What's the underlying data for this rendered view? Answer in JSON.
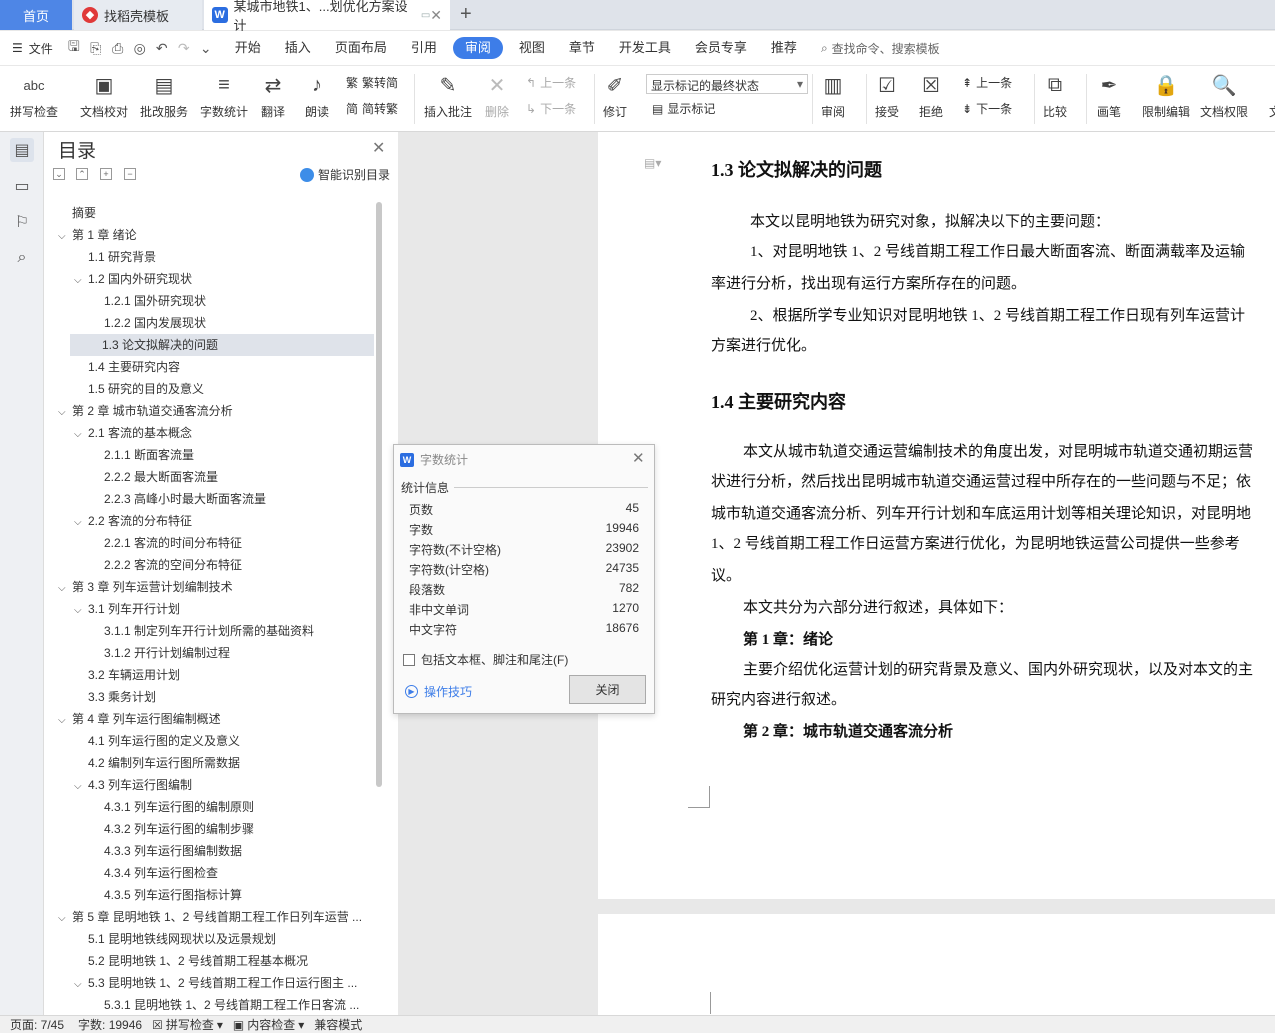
{
  "tabs": {
    "home": "首页",
    "template": "找稻壳模板",
    "doc": "某城市地铁1、...划优化方案设计"
  },
  "menubar": {
    "file": "文件",
    "items": [
      "开始",
      "插入",
      "页面布局",
      "引用",
      "审阅",
      "视图",
      "章节",
      "开发工具",
      "会员专享",
      "推荐"
    ],
    "active": "审阅",
    "search": "查找命令、搜索模板"
  },
  "ribbon": {
    "spellcheck": "拼写检查",
    "proofread": "文档校对",
    "batch": "批改服务",
    "wordcount": "字数统计",
    "translate": "翻译",
    "read": "朗读",
    "to_trad": "繁转简",
    "to_simp": "简转繁",
    "insert_comment": "插入批注",
    "delete": "删除",
    "prev_comment": "上一条",
    "next_comment": "下一条",
    "revise": "修订",
    "markup_state": "显示标记的最终状态",
    "show_markup": "显示标记",
    "review": "审阅",
    "accept": "接受",
    "reject": "拒绝",
    "prev_change": "上一条",
    "next_change": "下一条",
    "compare": "比较",
    "pen": "画笔",
    "restrict": "限制编辑",
    "permission": "文档权限",
    "more": "文"
  },
  "toc": {
    "title": "目录",
    "smart": "智能识别目录",
    "items": [
      {
        "label": "摘要",
        "level": 0,
        "caret": false
      },
      {
        "label": "第 1 章  绪论",
        "level": 0,
        "caret": true
      },
      {
        "label": "1.1 研究背景",
        "level": 1,
        "caret": false
      },
      {
        "label": "1.2 国内外研究现状",
        "level": 1,
        "caret": true
      },
      {
        "label": "1.2.1 国外研究现状",
        "level": 2,
        "caret": false
      },
      {
        "label": "1.2.2 国内发展现状",
        "level": 2,
        "caret": false
      },
      {
        "label": "1.3 论文拟解决的问题",
        "level": 1,
        "caret": false,
        "selected": true
      },
      {
        "label": "1.4 主要研究内容",
        "level": 1,
        "caret": false
      },
      {
        "label": "1.5 研究的目的及意义",
        "level": 1,
        "caret": false
      },
      {
        "label": "第 2 章  城市轨道交通客流分析",
        "level": 0,
        "caret": true
      },
      {
        "label": "2.1 客流的基本概念",
        "level": 1,
        "caret": true
      },
      {
        "label": "2.1.1 断面客流量",
        "level": 2,
        "caret": false
      },
      {
        "label": "2.2.2 最大断面客流量",
        "level": 2,
        "caret": false
      },
      {
        "label": "2.2.3 高峰小时最大断面客流量",
        "level": 2,
        "caret": false
      },
      {
        "label": "2.2 客流的分布特征",
        "level": 1,
        "caret": true
      },
      {
        "label": "2.2.1 客流的时间分布特征",
        "level": 2,
        "caret": false
      },
      {
        "label": "2.2.2 客流的空间分布特征",
        "level": 2,
        "caret": false
      },
      {
        "label": "第 3 章  列车运营计划编制技术",
        "level": 0,
        "caret": true
      },
      {
        "label": "3.1 列车开行计划",
        "level": 1,
        "caret": true
      },
      {
        "label": "3.1.1 制定列车开行计划所需的基础资料",
        "level": 2,
        "caret": false
      },
      {
        "label": "3.1.2 开行计划编制过程",
        "level": 2,
        "caret": false
      },
      {
        "label": "3.2 车辆运用计划",
        "level": 1,
        "caret": false
      },
      {
        "label": "3.3 乘务计划",
        "level": 1,
        "caret": false
      },
      {
        "label": "第 4 章  列车运行图编制概述",
        "level": 0,
        "caret": true
      },
      {
        "label": "4.1 列车运行图的定义及意义",
        "level": 1,
        "caret": false
      },
      {
        "label": "4.2 编制列车运行图所需数据",
        "level": 1,
        "caret": false
      },
      {
        "label": "4.3 列车运行图编制",
        "level": 1,
        "caret": true
      },
      {
        "label": "4.3.1 列车运行图的编制原则",
        "level": 2,
        "caret": false
      },
      {
        "label": "4.3.2 列车运行图的编制步骤",
        "level": 2,
        "caret": false
      },
      {
        "label": "4.3.3 列车运行图编制数据",
        "level": 2,
        "caret": false
      },
      {
        "label": "4.3.4 列车运行图检查",
        "level": 2,
        "caret": false
      },
      {
        "label": "4.3.5 列车运行图指标计算",
        "level": 2,
        "caret": false
      },
      {
        "label": "第 5 章  昆明地铁 1、2 号线首期工程工作日列车运营 ...",
        "level": 0,
        "caret": true
      },
      {
        "label": "5.1 昆明地铁线网现状以及远景规划",
        "level": 1,
        "caret": false
      },
      {
        "label": "5.2 昆明地铁 1、2 号线首期工程基本概况",
        "level": 1,
        "caret": false
      },
      {
        "label": "5.3 昆明地铁 1、2 号线首期工程工作日运行图主 ...",
        "level": 1,
        "caret": true
      },
      {
        "label": "5.3.1 昆明地铁 1、2 号线首期工程工作日客流 ...",
        "level": 2,
        "caret": false
      }
    ]
  },
  "document": {
    "lines": [
      {
        "text": "1.3 论文拟解决的问题",
        "style": "h"
      },
      {
        "text": "本文以昆明地铁为研究对象，拟解决以下的主要问题：",
        "style": "p"
      },
      {
        "text": "1、对昆明地铁 1、2 号线首期工程工作日最大断面客流、断面满载率及运输",
        "style": "p"
      },
      {
        "text": "率进行分析，找出现有运行方案所存在的问题。",
        "style": "p"
      },
      {
        "text": "2、根据所学专业知识对昆明地铁 1、2 号线首期工程工作日现有列车运营计",
        "style": "p"
      },
      {
        "text": "方案进行优化。",
        "style": "p"
      },
      {
        "text": "1.4 主要研究内容",
        "style": "h"
      },
      {
        "text": "本文从城市轨道交通运营编制技术的角度出发，对昆明城市轨道交通初期运营",
        "style": "p"
      },
      {
        "text": "状进行分析，然后找出昆明城市轨道交通运营过程中所存在的一些问题与不足；依",
        "style": "p"
      },
      {
        "text": "城市轨道交通客流分析、列车开行计划和车底运用计划等相关理论知识，对昆明地",
        "style": "p"
      },
      {
        "text": "1、2 号线首期工程工作日运营方案进行优化，为昆明地铁运营公司提供一些参考",
        "style": "p"
      },
      {
        "text": "议。",
        "style": "p"
      },
      {
        "text": "本文共分为六部分进行叙述，具体如下：",
        "style": "p"
      },
      {
        "text": "第 1 章：绪论",
        "style": "b"
      },
      {
        "text": "主要介绍优化运营计划的研究背景及意义、国内外研究现状，以及对本文的主",
        "style": "p"
      },
      {
        "text": "研究内容进行叙述。",
        "style": "p"
      },
      {
        "text": "第 2 章：城市轨道交通客流分析",
        "style": "b"
      }
    ]
  },
  "dialog": {
    "title": "字数统计",
    "group": "统计信息",
    "stats": [
      {
        "label": "页数",
        "value": "45"
      },
      {
        "label": "字数",
        "value": "19946"
      },
      {
        "label": "字符数(不计空格)",
        "value": "23902"
      },
      {
        "label": "字符数(计空格)",
        "value": "24735"
      },
      {
        "label": "段落数",
        "value": "782"
      },
      {
        "label": "非中文单词",
        "value": "1270"
      },
      {
        "label": "中文字符",
        "value": "18676"
      }
    ],
    "checkbox": "包括文本框、脚注和尾注(F)",
    "tips": "操作技巧",
    "close": "关闭"
  },
  "status": {
    "page": "页面: 7/45",
    "words": "字数: 19946",
    "spell": "拼写检查",
    "content": "内容检查",
    "compat": "兼容模式"
  },
  "colors": {
    "accent": "#3d7de8",
    "home_tab": "#4e86e6"
  }
}
